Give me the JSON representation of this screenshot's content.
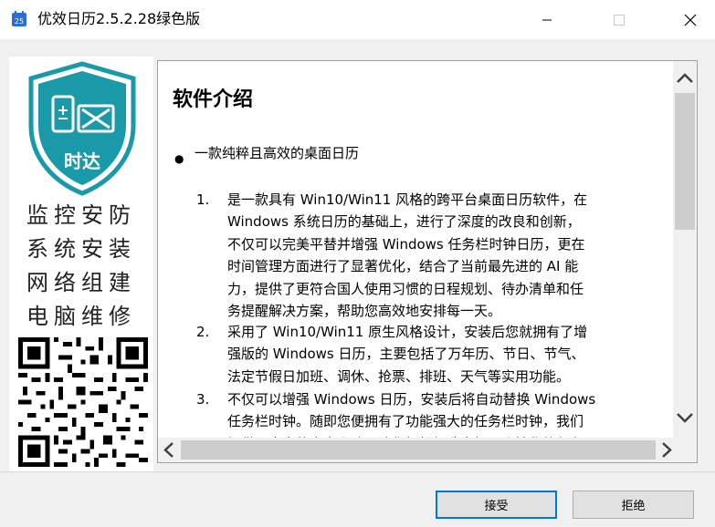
{
  "window": {
    "title": "优效日历2.5.2.28绿色版",
    "icon_label": "25"
  },
  "sidebar": {
    "shield_text": "时达",
    "slogans": [
      "监控安防",
      "系统安装",
      "网络组建",
      "电脑维修"
    ]
  },
  "content": {
    "heading": "软件介绍",
    "bullet": "一款纯粹且高效的桌面日历",
    "items": [
      {
        "num": "1.",
        "lines": [
          "是一款具有 Win10/Win11 风格的跨平台桌面日历软件，在",
          "Windows 系统日历的基础上，进行了深度的改良和创新，",
          "不仅可以完美平替并增强 Windows 任务栏时钟日历，更在",
          "时间管理方面进行了显著优化，结合了当前最先进的 AI 能",
          "力，提供了更符合国人使用习惯的日程规划、待办清单和任",
          "务提醒解决方案，帮助您高效地安排每一天。"
        ]
      },
      {
        "num": "2.",
        "lines": [
          "采用了 Win10/Win11 原生风格设计，安装后您就拥有了增",
          "强版的 Windows 日历，主要包括了万年历、节日、节气、",
          "法定节假日加班、调休、抢票、排班、天气等实用功能。"
        ]
      },
      {
        "num": "3.",
        "lines": [
          "不仅可以增强 Windows 日历，安装后将自动替换 Windows",
          "任务栏时钟。随即您便拥有了功能强大的任务栏时钟，我们",
          "提供了丰富的自定义选项让您轻松打造出极具个性化的任务"
        ]
      }
    ]
  },
  "buttons": {
    "accept": "接受",
    "decline": "拒绝"
  },
  "colors": {
    "accent": "#0078d7",
    "shield_teal": "#1a9aa8",
    "icon_blue": "#2b6fd6"
  }
}
